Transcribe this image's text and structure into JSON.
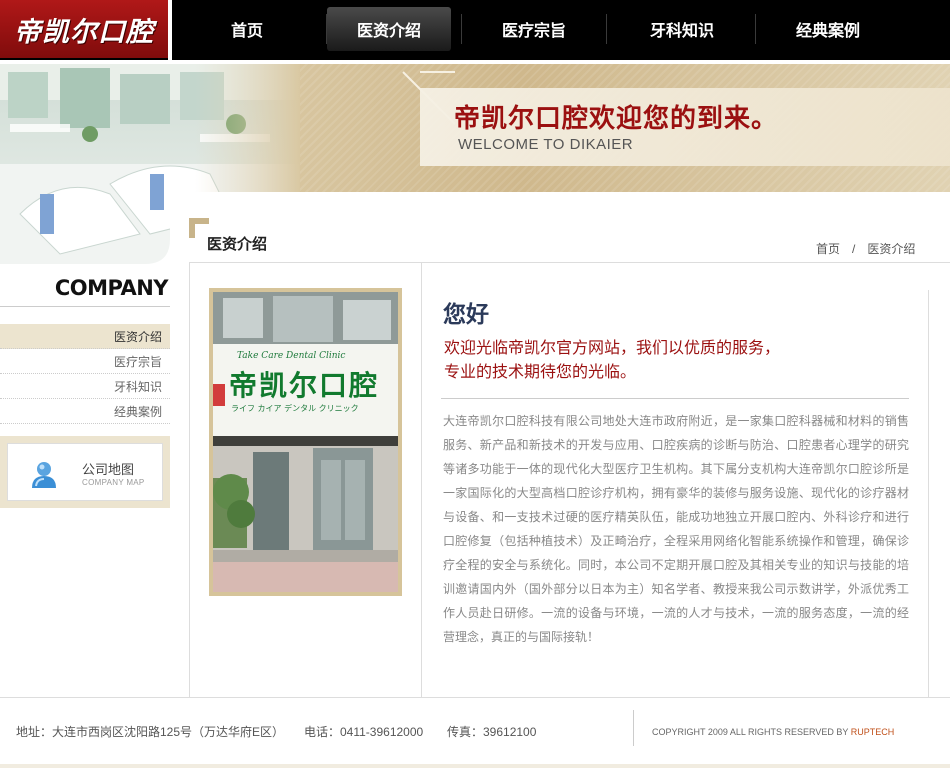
{
  "header": {
    "logo_text": "帝凯尔口腔",
    "nav": [
      {
        "label": "首页",
        "active": false
      },
      {
        "label": "医资介绍",
        "active": true
      },
      {
        "label": "医疗宗旨",
        "active": false
      },
      {
        "label": "牙科知识",
        "active": false
      },
      {
        "label": "经典案例",
        "active": false
      }
    ]
  },
  "banner": {
    "welcome_cn": "帝凯尔口腔欢迎您的到来。",
    "welcome_en": "WELCOME TO DIKAIER"
  },
  "sidebar": {
    "company_title": "COMPANY",
    "items": [
      {
        "label": "医资介绍",
        "active": true
      },
      {
        "label": "医疗宗旨",
        "active": false
      },
      {
        "label": "牙科知识",
        "active": false
      },
      {
        "label": "经典案例",
        "active": false
      }
    ],
    "map": {
      "title": "公司地图",
      "subtitle": "COMPANY MAP"
    }
  },
  "main": {
    "section_title": "医资介绍",
    "breadcrumb": {
      "home": "首页",
      "separator": "/",
      "current": "医资介绍"
    },
    "photo_sign": {
      "line1": "Take Care Dental Clinic",
      "chars": "帝凯尔口腔",
      "line3": "ライフ カイア デンタル クリニック"
    },
    "hello": "您好",
    "intro_lines": [
      "欢迎光临帝凯尔官方网站，我们以优质的服务，",
      "专业的技术期待您的光临。"
    ],
    "body": "大连帝凯尔口腔科技有限公司地处大连市政府附近，是一家集口腔科器械和材料的销售服务、新产品和新技术的开发与应用、口腔疾病的诊断与防治、口腔患者心理学的研究等诸多功能于一体的现代化大型医疗卫生机构。其下属分支机构大连帝凯尔口腔诊所是一家国际化的大型高档口腔诊疗机构，拥有豪华的装修与服务设施、现代化的诊疗器材与设备、和一支技术过硬的医疗精英队伍，能成功地独立开展口腔内、外科诊疗和进行口腔修复（包括种植技术）及正畸治疗，全程采用网络化智能系统操作和管理，确保诊疗全程的安全与系统化。同时，本公司不定期开展口腔及其相关专业的知识与技能的培训邀请国内外（国外部分以日本为主）知名学者、教授来我公司示数讲学，外派优秀工作人员赴日研修。一流的设备与环境，一流的人才与技术，一流的服务态度，一流的经营理念，真正的与国际接轨！"
  },
  "footer": {
    "address": "地址：大连市西岗区沈阳路125号（万达华府E区）",
    "tel": "电话：0411-39612000",
    "fax": "传真：39612100",
    "copyright": "COPYRIGHT 2009 ALL RIGHTS RESERVED BY",
    "copyright_brand": "RUPTECH"
  },
  "colors": {
    "brand_red": "#9b1010",
    "nav_bg": "#000000",
    "accent_beige": "#ece4cf",
    "heading_navy": "#2b3a5a"
  }
}
